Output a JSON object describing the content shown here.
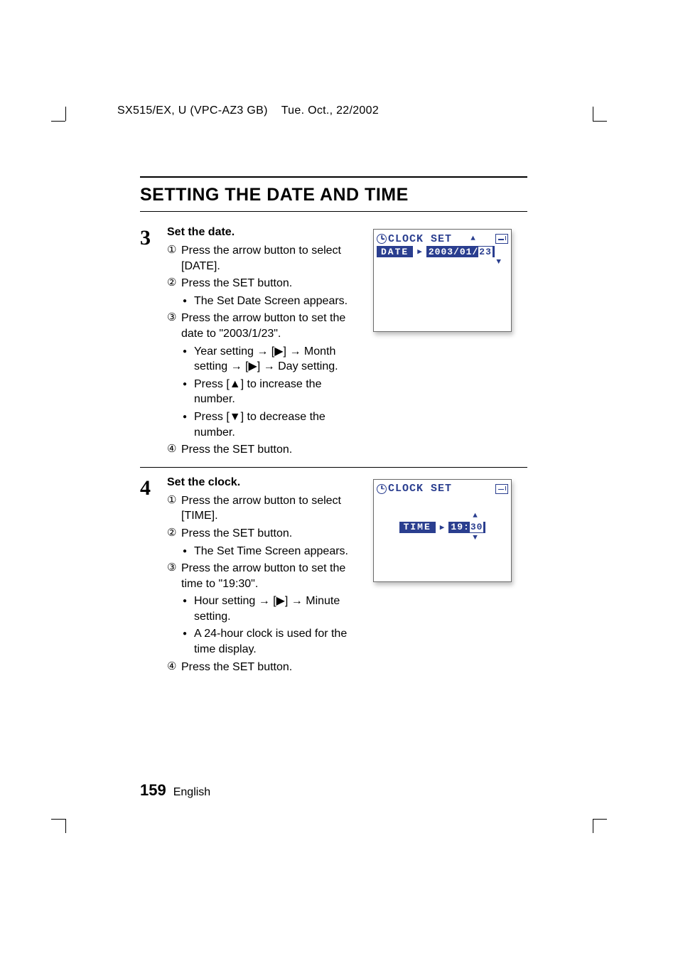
{
  "header": {
    "model": "SX515/EX, U (VPC-AZ3 GB)",
    "date": "Tue. Oct., 22/2002"
  },
  "title": "SETTING THE DATE AND TIME",
  "steps": {
    "s3": {
      "num": "3",
      "title": "Set the date.",
      "subs": {
        "a": {
          "num": "①",
          "text": "Press the arrow button to select [DATE]."
        },
        "b": {
          "num": "②",
          "text": "Press the SET button."
        },
        "b1": {
          "text": "The Set Date Screen appears."
        },
        "c": {
          "num": "③",
          "text": "Press the arrow button to set the date to \"2003/1/23\"."
        },
        "c1": {
          "text": "Year setting → [▶] → Month setting → [▶] → Day setting."
        },
        "c2": {
          "text": "Press [▲] to increase the number."
        },
        "c3": {
          "text": "Press [▼] to decrease the number."
        },
        "d": {
          "num": "④",
          "text": "Press the SET button."
        }
      },
      "lcd": {
        "title": "CLOCK SET",
        "label": "DATE",
        "val_ym": "2003/01/",
        "val_d": "23"
      }
    },
    "s4": {
      "num": "4",
      "title": "Set the clock.",
      "subs": {
        "a": {
          "num": "①",
          "text": "Press the arrow button to select [TIME]."
        },
        "b": {
          "num": "②",
          "text": "Press the SET button."
        },
        "b1": {
          "text": "The Set Time Screen appears."
        },
        "c": {
          "num": "③",
          "text": "Press the arrow button to set the time to \"19:30\"."
        },
        "c1": {
          "text": "Hour setting → [▶] → Minute setting."
        },
        "c2": {
          "text": "A 24-hour clock is used for the time display."
        },
        "d": {
          "num": "④",
          "text": "Press the SET button."
        }
      },
      "lcd": {
        "title": "CLOCK SET",
        "label": "TIME",
        "val_h": "19:",
        "val_m": "30"
      }
    }
  },
  "footer": {
    "page": "159",
    "lang": "English"
  }
}
